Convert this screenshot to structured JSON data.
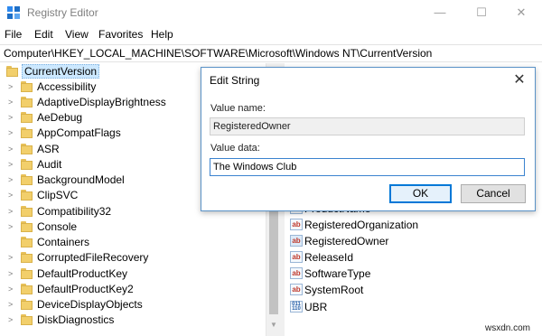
{
  "window": {
    "title": "Registry Editor",
    "minimize_glyph": "—",
    "maximize_glyph": "☐",
    "close_glyph": "✕"
  },
  "menu": [
    "File",
    "Edit",
    "View",
    "Favorites",
    "Help"
  ],
  "address": "Computer\\HKEY_LOCAL_MACHINE\\SOFTWARE\\Microsoft\\Windows NT\\CurrentVersion",
  "tree": {
    "root": "CurrentVersion",
    "children": [
      "Accessibility",
      "AdaptiveDisplayBrightness",
      "AeDebug",
      "AppCompatFlags",
      "ASR",
      "Audit",
      "BackgroundModel",
      "ClipSVC",
      "Compatibility32",
      "Console",
      "Containers",
      "CorruptedFileRecovery",
      "DefaultProductKey",
      "DefaultProductKey2",
      "DeviceDisplayObjects",
      "DiskDiagnostics"
    ]
  },
  "values": [
    {
      "name": "ProductName",
      "icon": "string-value-icon"
    },
    {
      "name": "RegisteredOrganization",
      "icon": "string-value-icon"
    },
    {
      "name": "RegisteredOwner",
      "icon": "string-value-icon"
    },
    {
      "name": "ReleaseId",
      "icon": "string-value-icon"
    },
    {
      "name": "SoftwareType",
      "icon": "string-value-icon"
    },
    {
      "name": "SystemRoot",
      "icon": "string-value-icon"
    },
    {
      "name": "UBR",
      "icon": "binary-value-icon"
    }
  ],
  "dialog": {
    "title": "Edit String",
    "value_name_label": "Value name:",
    "value_name": "RegisteredOwner",
    "value_data_label": "Value data:",
    "value_data": "The Windows Club",
    "ok_label": "OK",
    "cancel_label": "Cancel"
  },
  "watermark": "wsxdn.com",
  "colors": {
    "selection": "#cce8ff",
    "focus_border": "#0078d7",
    "folder": "#f2cf6b"
  }
}
